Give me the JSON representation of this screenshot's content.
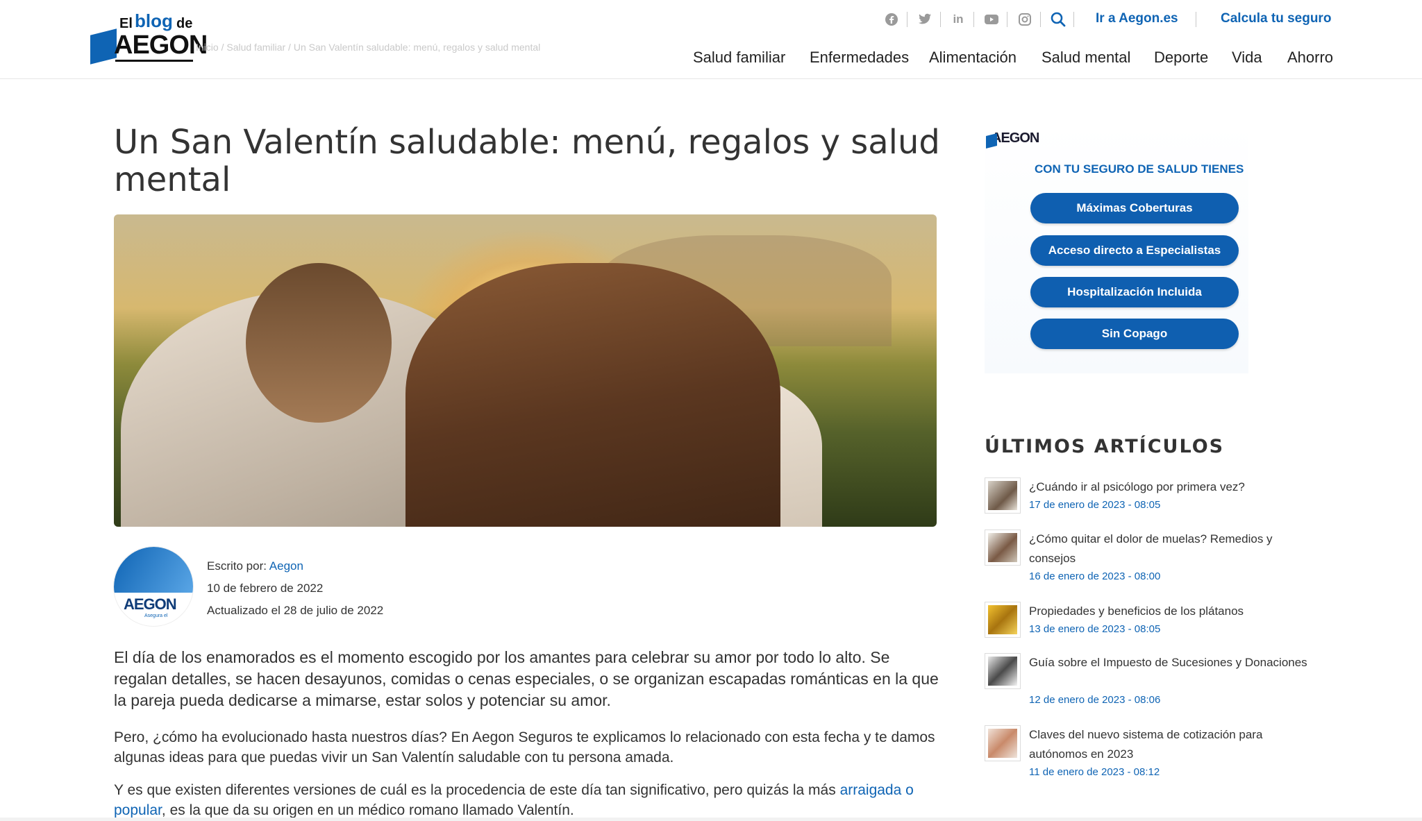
{
  "logo": {
    "el": "El",
    "blog": "blog",
    "de": "de",
    "brand": "AEGON"
  },
  "breadcrumb": "Inicio  /  Salud familiar  /  Un San Valentín saludable: menú, regalos y salud mental",
  "topbar": {
    "social": [
      "facebook-icon",
      "twitter-icon",
      "linkedin-icon",
      "youtube-icon",
      "instagram-icon"
    ],
    "link_aegon": "Ir a Aegon.es",
    "link_seguro": "Calcula tu seguro"
  },
  "nav": [
    "Salud familiar",
    "Enfermedades",
    "Alimentación",
    "Salud mental",
    "Deporte",
    "Vida",
    "Ahorro"
  ],
  "article": {
    "title": "Un San Valentín saludable: menú, regalos y salud mental",
    "author_label": "Escrito por:",
    "author": "Aegon",
    "date": "10 de febrero de 2022",
    "updated": "Actualizado el 28 de julio de 2022",
    "avatar_brand": "AEGON",
    "avatar_tagline": "Asegura el",
    "lead": "El día de los enamorados es el momento escogido por los amantes para celebrar su amor por todo lo alto. Se regalan detalles, se hacen desayunos, comidas o cenas especiales, o se organizan escapadas románticas en la que la pareja pueda dedicarse a mimarse, estar solos y potenciar su amor.",
    "p1": "Pero, ¿cómo ha evolucionado hasta nuestros días? En Aegon Seguros te explicamos lo relacionado con esta fecha y te damos algunas ideas para que puedas vivir un San Valentín saludable con tu persona amada.",
    "p2_before": "Y es que existen diferentes versiones de cuál es la procedencia de este día tan significativo, pero quizás la más ",
    "p2_link": "arraigada o popular",
    "p2_after": ", es la que da su origen en un médico romano llamado Valentín."
  },
  "ad": {
    "brand": "AEGON",
    "heading": "CON TU SEGURO DE SALUD TIENES",
    "buttons": [
      "Máximas Coberturas",
      "Acceso directo a Especialistas",
      "Hospitalización Incluida",
      "Sin Copago"
    ]
  },
  "latest": {
    "heading": "ÚLTIMOS ARTÍCULOS",
    "items": [
      {
        "title": "¿Cuándo ir al psicólogo por primera vez?",
        "date": "17 de enero de 2023 - 08:05"
      },
      {
        "title": "¿Cómo quitar el dolor de muelas? Remedios y consejos",
        "date": "16 de enero de 2023 - 08:00"
      },
      {
        "title": "Propiedades y beneficios de los plátanos",
        "date": "13 de enero de 2023 - 08:05"
      },
      {
        "title": "Guía sobre el Impuesto de Sucesiones y Donaciones",
        "date": "12 de enero de 2023 - 08:06"
      },
      {
        "title": "Claves del nuevo sistema de cotización para autónomos en 2023",
        "date": "11 de enero de 2023 - 08:12"
      }
    ]
  },
  "colors": {
    "accent": "#0f64b4",
    "text": "#333333",
    "border": "#e6e6e6"
  }
}
